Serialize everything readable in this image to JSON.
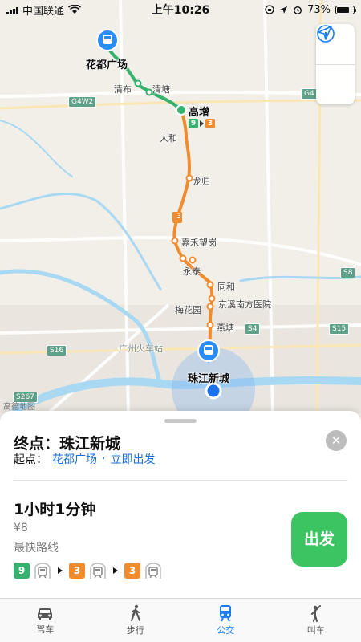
{
  "status_bar": {
    "carrier": "中国联通",
    "time": "上午10:26",
    "battery": "73%",
    "battery_level": 0.73
  },
  "map": {
    "stations": {
      "start": "花都广场",
      "qingbu": "清布",
      "qingtang": "清塘",
      "gaozeng": "高增",
      "renhe": "人和",
      "longgui": "龙归",
      "jiahe": "嘉禾望岗",
      "yongtai": "永泰",
      "tonghe": "同和",
      "jingxi": "京溪南方医院",
      "meihua": "梅花园",
      "yantang": "燕塘",
      "end": "珠江新城"
    },
    "other_labels": {
      "railway": "广州火车站"
    },
    "highways": [
      "G4W2",
      "G4",
      "S8",
      "S4",
      "S15",
      "S16",
      "S267"
    ],
    "line_badge_3": "3",
    "line_badge_9": "9",
    "gaozeng_badges": [
      "9",
      "3"
    ],
    "watermark": "高德地图",
    "info_icon": "info-icon",
    "locate_icon": "location-arrow-icon",
    "colors": {
      "line9": "#35b36e",
      "line3": "#f08b2e",
      "water": "#a9d8f2",
      "pin": "#2a8cf7"
    }
  },
  "sheet": {
    "destination": "终点：珠江新城",
    "origin_label": "起点：",
    "origin_value": "花都广场",
    "separator": "·",
    "depart_now": "立即出发",
    "duration": "1小时1分钟",
    "price": "¥8",
    "route_type": "最快路线",
    "steps": [
      {
        "line": "9",
        "color": "green"
      },
      {
        "line": "3",
        "color": "orange"
      },
      {
        "line": "3",
        "color": "orange"
      }
    ],
    "go_button": "出发"
  },
  "tabs": [
    {
      "label": "驾车",
      "icon": "car-icon"
    },
    {
      "label": "步行",
      "icon": "walk-icon"
    },
    {
      "label": "公交",
      "icon": "train-icon",
      "active": true
    },
    {
      "label": "叫车",
      "icon": "hail-icon"
    }
  ]
}
